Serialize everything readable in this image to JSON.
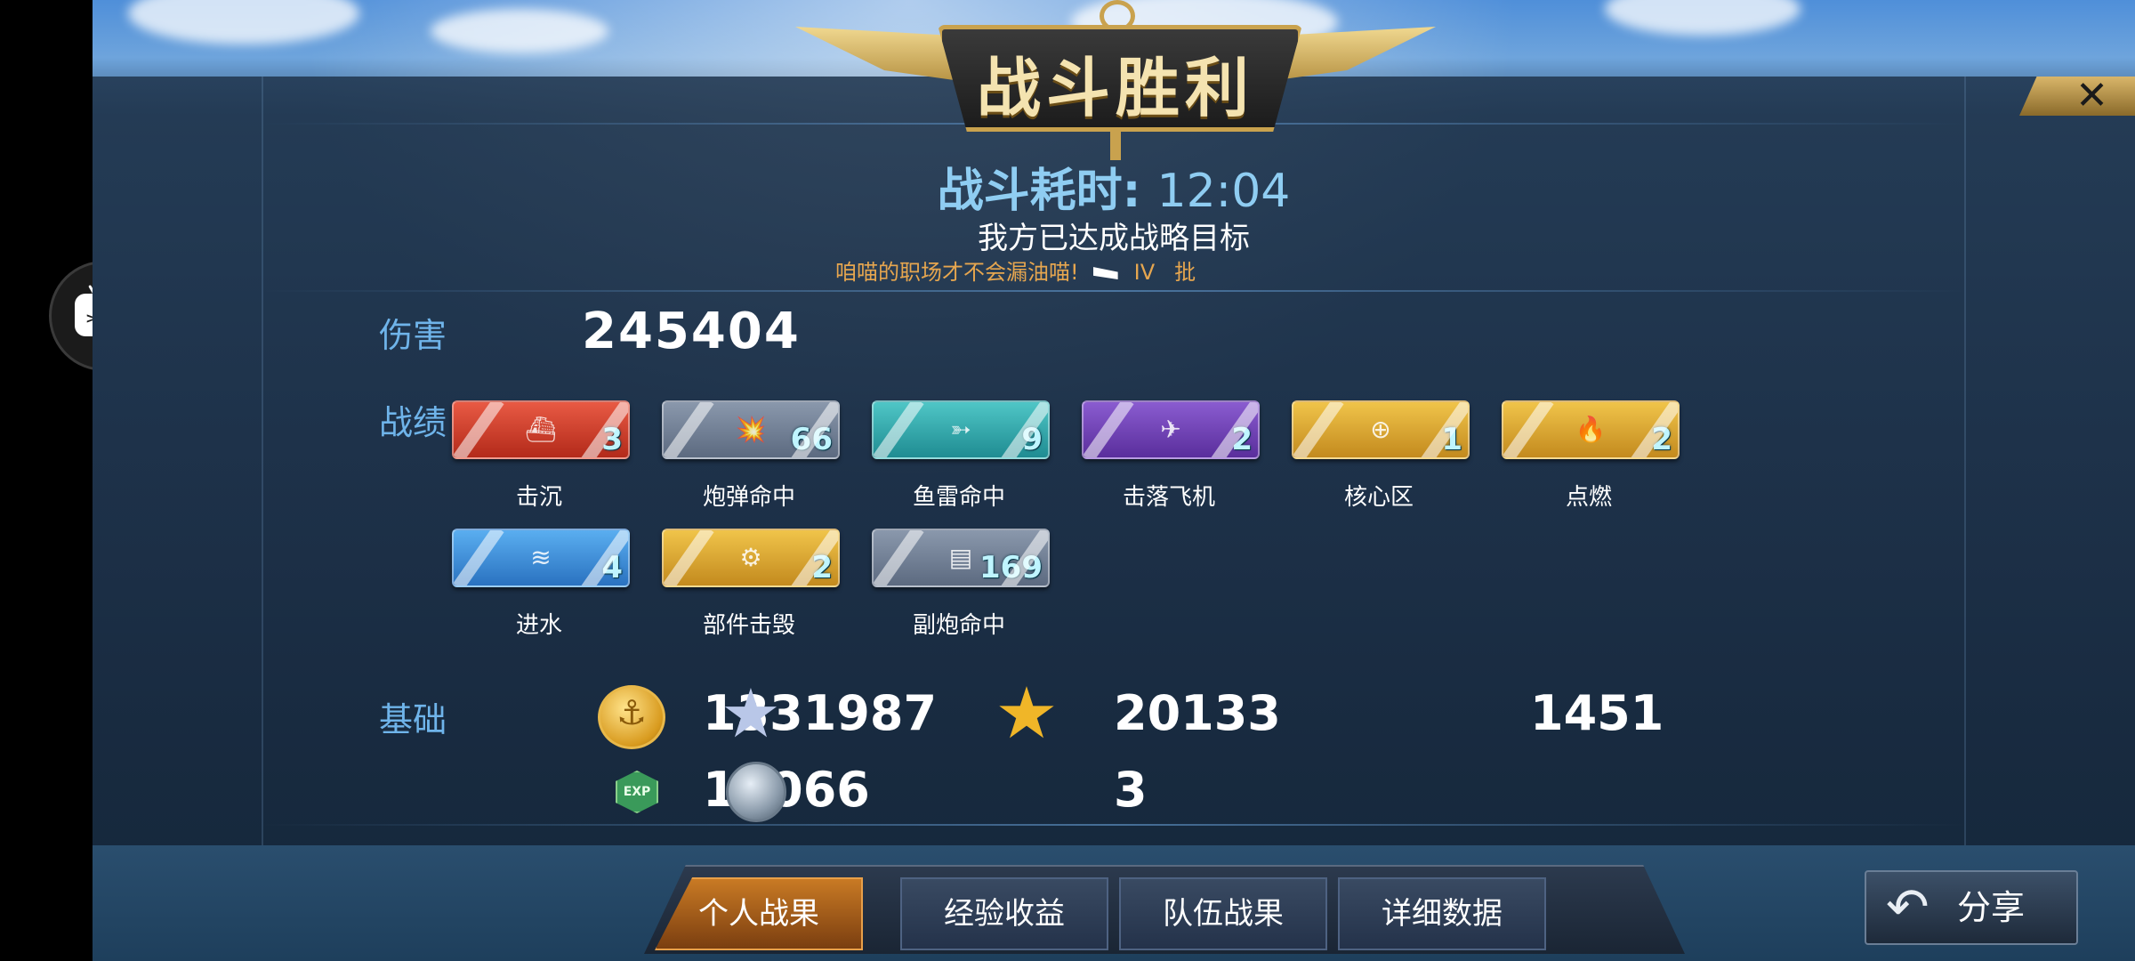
{
  "header": {
    "title": "战斗胜利",
    "battle_time_label": "战斗耗时:",
    "battle_time_value": "12:04",
    "objective": "我方已达成战略目标",
    "slogan": "咱喵的职场才不会漏油喵!",
    "tier": "IV",
    "batch": "批"
  },
  "sections": {
    "damage_label": "伤害",
    "record_label": "战绩",
    "base_label": "基础"
  },
  "damage": {
    "value": "245404"
  },
  "achievements": [
    {
      "label": "击沉",
      "count": "3",
      "color": "red",
      "icon": "ship-sinking-icon"
    },
    {
      "label": "炮弹命中",
      "count": "66",
      "color": "gray",
      "icon": "shell-hit-icon"
    },
    {
      "label": "鱼雷命中",
      "count": "9",
      "color": "teal",
      "icon": "torpedo-icon"
    },
    {
      "label": "击落飞机",
      "count": "2",
      "color": "purple",
      "icon": "plane-downed-icon"
    },
    {
      "label": "核心区",
      "count": "1",
      "color": "gold",
      "icon": "citadel-icon"
    },
    {
      "label": "点燃",
      "count": "2",
      "color": "gold",
      "icon": "fire-icon"
    },
    {
      "label": "进水",
      "count": "4",
      "color": "blue",
      "icon": "flooding-icon"
    },
    {
      "label": "部件击毁",
      "count": "2",
      "color": "gold",
      "icon": "gear-icon"
    },
    {
      "label": "副炮命中",
      "count": "169",
      "color": "gray",
      "icon": "secondary-gun-icon"
    }
  ],
  "resources": {
    "coins": "1331987",
    "silver_star": "20133",
    "gold_star": "1451",
    "exp": "10066",
    "globe": "3",
    "exp_badge_text": "EXP"
  },
  "tabs": [
    {
      "label": "个人战果",
      "active": true
    },
    {
      "label": "经验收益",
      "active": false
    },
    {
      "label": "队伍战果",
      "active": false
    },
    {
      "label": "详细数据",
      "active": false
    }
  ],
  "share": {
    "label": "分享"
  },
  "close": {
    "glyph": "✕"
  },
  "colors": {
    "label_blue": "#6fb4ea",
    "time_blue": "#8fcdf2",
    "slogan_orange": "#e6a64f",
    "count_cyan": "#bff5ff",
    "gold": "#c9a24e"
  }
}
